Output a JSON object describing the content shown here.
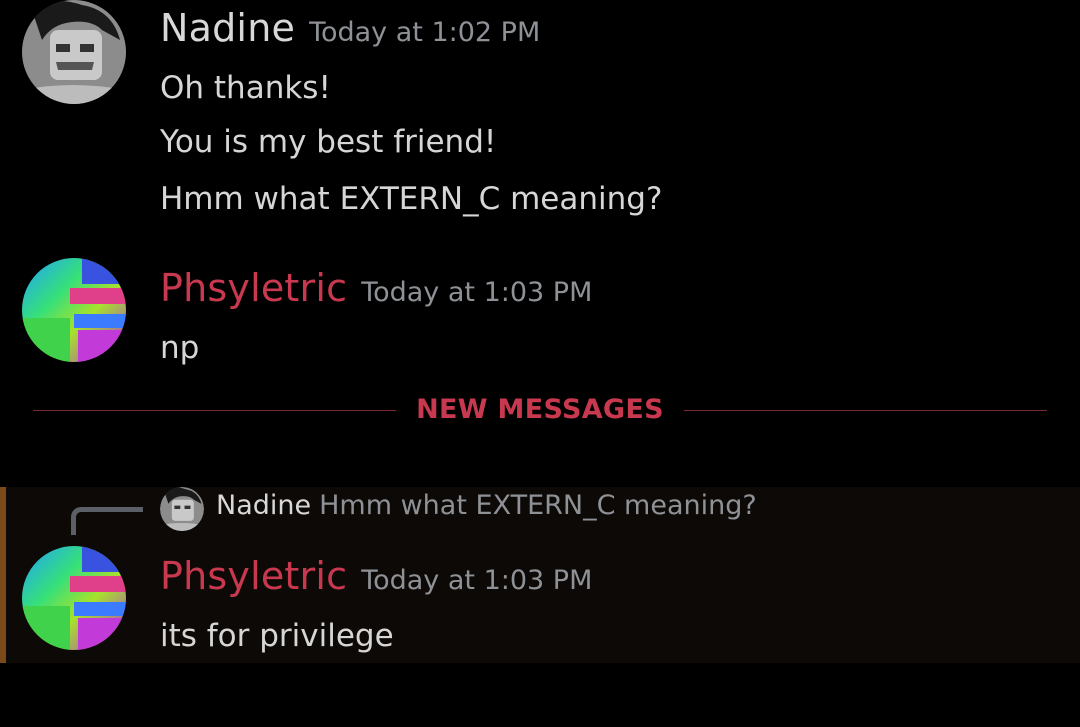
{
  "messages": [
    {
      "username": "Nadine",
      "timestamp": "Today at 1:02 PM",
      "lines": [
        "Oh thanks!",
        "You is my best friend!",
        "Hmm what EXTERN_C meaning?"
      ]
    },
    {
      "username": "Phsyletric",
      "timestamp": "Today at 1:03 PM",
      "lines": [
        "np"
      ]
    }
  ],
  "divider": {
    "label": "NEW MESSAGES"
  },
  "reply": {
    "replied_to_name": "Nadine",
    "replied_to_text": "Hmm what EXTERN_C meaning?",
    "username": "Phsyletric",
    "timestamp": "Today at 1:03 PM",
    "text": "its for privilege"
  },
  "colors": {
    "accent_red": "#c8394f",
    "text": "#d6d6d6",
    "muted": "#8e9297",
    "background": "#000000",
    "highlight_bg": "#0d0906",
    "highlight_border": "#7a4a1a"
  }
}
